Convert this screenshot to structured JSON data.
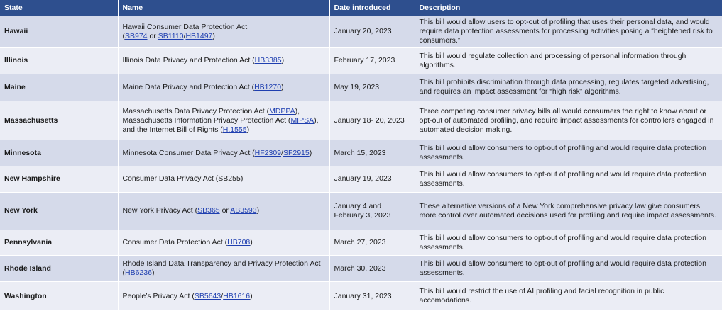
{
  "table": {
    "headers": [
      "State",
      "Name",
      "Date introduced",
      "Description"
    ],
    "rows": [
      {
        "state": "Hawaii",
        "name": [
          {
            "text": "Hawaii Consumer Data Protection Act"
          },
          {
            "br": true
          },
          {
            "text": "("
          },
          {
            "link": "SB974"
          },
          {
            "text": " or "
          },
          {
            "link": "SB1110"
          },
          {
            "text": "/"
          },
          {
            "link": "HB1497"
          },
          {
            "text": ")"
          }
        ],
        "date": "January 20, 2023",
        "description": "This bill would allow users to opt-out of profiling that uses their personal data, and would require data protection assessments for processing activities posing a “heightened risk to consumers.”"
      },
      {
        "state": "Illinois",
        "name": [
          {
            "text": "Illinois Data Privacy and Protection Act ("
          },
          {
            "link": "HB3385"
          },
          {
            "text": ")"
          }
        ],
        "date": "February 17, 2023",
        "description": "This bill would regulate collection and processing of personal information through algorithms."
      },
      {
        "state": "Maine",
        "name": [
          {
            "text": "Maine Data Privacy and Protection Act ("
          },
          {
            "link": "HB1270"
          },
          {
            "text": ")"
          }
        ],
        "date": "May 19, 2023",
        "description": "This bill prohibits discrimination through data processing, regulates targeted advertising, and requires an impact assessment for “high risk” algorithms."
      },
      {
        "state": "Massachusetts",
        "name": [
          {
            "text": "Massachusetts Data Privacy Protection Act ("
          },
          {
            "link": "MDPPA"
          },
          {
            "text": "),"
          },
          {
            "br": true
          },
          {
            "text": "Massachusetts Information Privacy Protection Act ("
          },
          {
            "link": "MIPSA"
          },
          {
            "text": "),"
          },
          {
            "br": true
          },
          {
            "text": "and the Internet Bill of Rights ("
          },
          {
            "link": "H.1555"
          },
          {
            "text": ")"
          }
        ],
        "date": "January 18- 20, 2023",
        "description": "Three competing consumer privacy bills all would consumers the right to know about or opt-out of automated profiling, and require impact assessments for controllers engaged in automated decision making."
      },
      {
        "state": "Minnesota",
        "name": [
          {
            "text": "Minnesota Consumer Data Privacy Act ("
          },
          {
            "link": "HF2309"
          },
          {
            "text": "/"
          },
          {
            "link": "SF2915"
          },
          {
            "text": ")"
          }
        ],
        "date": "March 15, 2023",
        "description": "This bill would allow consumers to opt-out of profiling and would require data protection assessments."
      },
      {
        "state": "New Hampshire",
        "name": [
          {
            "text": "Consumer Data Privacy Act (SB255)"
          }
        ],
        "date": "January 19, 2023",
        "description": "This bill would allow consumers to opt-out of profiling and would require data protection assessments."
      },
      {
        "state": "New York",
        "name": [
          {
            "text": "New York Privacy Act ("
          },
          {
            "link": "SB365"
          },
          {
            "text": " or "
          },
          {
            "link": "AB3593"
          },
          {
            "text": ")"
          }
        ],
        "date": "January 4 and February 3, 2023",
        "description": "These alternative versions of a New York comprehensive privacy law give consumers more control over automated decisions used for profiling and require impact assessments."
      },
      {
        "state": "Pennsylvania",
        "name": [
          {
            "text": "Consumer Data Protection Act ("
          },
          {
            "link": "HB708"
          },
          {
            "text": ")"
          }
        ],
        "date": "March 27, 2023",
        "description": "This bill would allow consumers to opt-out of profiling and would require data protection assessments."
      },
      {
        "state": "Rhode Island",
        "name": [
          {
            "text": "Rhode Island Data Transparency and Privacy Protection Act"
          },
          {
            "br": true
          },
          {
            "text": "("
          },
          {
            "link": "HB6236"
          },
          {
            "text": ")"
          }
        ],
        "date": "March 30, 2023",
        "description": "This bill would allow consumers to opt-out of profiling and would require data protection assessments."
      },
      {
        "state": "Washington",
        "name": [
          {
            "text": "People’s Privacy Act ("
          },
          {
            "link": "SB5643"
          },
          {
            "text": "/"
          },
          {
            "link": "HB1616"
          },
          {
            "text": ")"
          }
        ],
        "date": "January 31, 2023",
        "description": "This bill would restrict the use of AI profiling and facial recognition in public accomodations."
      }
    ]
  }
}
